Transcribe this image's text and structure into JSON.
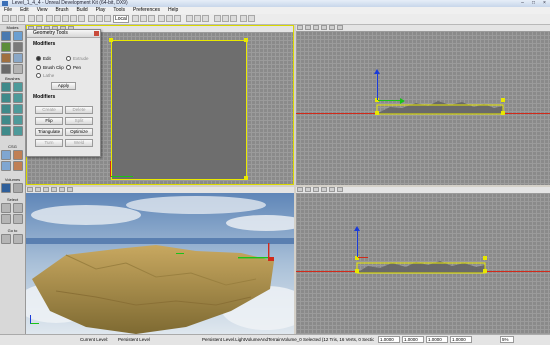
{
  "window": {
    "title": "Level_1_4_4 - Unreal Development Kit (64-bit, DX9)"
  },
  "menu": [
    "File",
    "Edit",
    "View",
    "Brush",
    "Build",
    "Play",
    "Tools",
    "Preferences",
    "Help"
  ],
  "toolbar": {
    "search_value": "",
    "grid_combo": "Local"
  },
  "left_toolbar": {
    "modes_label": "Modes",
    "brushes_label": "Brushes",
    "csg_label": "CSG",
    "volumes_label": "Volumes",
    "select_label": "Select",
    "goto_label": "Go to"
  },
  "geometry_tools": {
    "title": "Geometry Tools",
    "modifiers_header": "Modifiers",
    "radios": [
      {
        "label": "Edit",
        "selected": true
      },
      {
        "label": "Extrude",
        "selected": false
      },
      {
        "label": "Brush Clip",
        "selected": false
      },
      {
        "label": "Pen",
        "selected": false
      },
      {
        "label": "Lathe",
        "selected": false
      }
    ],
    "apply_label": "Apply",
    "modifiers2_header": "Modifiers",
    "buttons": [
      {
        "label": "Create",
        "enabled": false
      },
      {
        "label": "Delete",
        "enabled": false
      },
      {
        "label": "Flip",
        "enabled": true
      },
      {
        "label": "Split",
        "enabled": false
      },
      {
        "label": "Triangulate",
        "enabled": true
      },
      {
        "label": "Optimize",
        "enabled": true
      },
      {
        "label": "Turn",
        "enabled": false
      },
      {
        "label": "Weld",
        "enabled": false
      }
    ]
  },
  "status": {
    "current_level_label": "Current Level:",
    "current_level": "Persistent Level",
    "selection": "Persistent Level.LightVolumeAndTerrainVolume_0 Selected (12 Tris, 16 Verts, 0 Sections)",
    "val1": "1.0000",
    "val2": "1.0000",
    "val3": "1.0000",
    "val4": "1.0000",
    "zoom": "5%"
  },
  "colors": {
    "selection": "#e8e800",
    "x_axis": "#19c219",
    "y_axis": "#d12a1a",
    "z_axis": "#1a3bd9"
  }
}
